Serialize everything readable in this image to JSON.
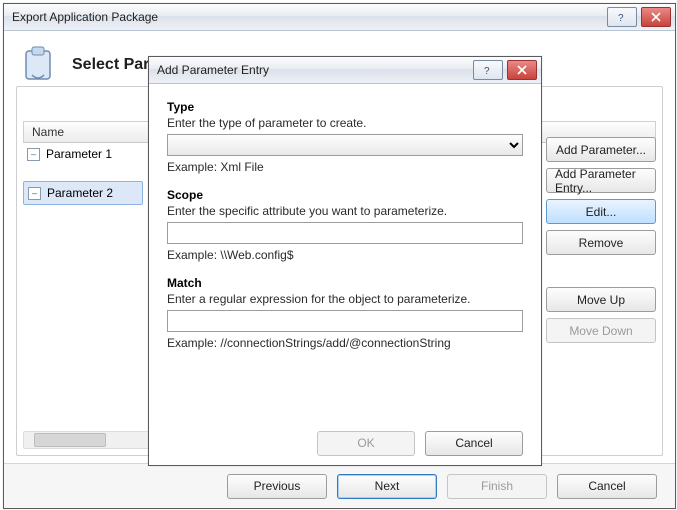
{
  "mainWindow": {
    "title": "Export Application Package",
    "heading": "Select Parameters",
    "gridHeader": "Name",
    "tree": {
      "items": [
        {
          "label": "Parameter 1"
        },
        {
          "label": "Parameter 2"
        }
      ]
    },
    "sideButtons": {
      "addParameter": "Add Parameter...",
      "addParameterEntry": "Add Parameter Entry...",
      "edit": "Edit...",
      "remove": "Remove",
      "moveUp": "Move Up",
      "moveDown": "Move Down"
    },
    "footer": {
      "previous": "Previous",
      "next": "Next",
      "finish": "Finish",
      "cancel": "Cancel"
    }
  },
  "dialog": {
    "title": "Add Parameter Entry",
    "type": {
      "heading": "Type",
      "hint": "Enter the type of parameter to create.",
      "value": "",
      "example": "Example: Xml File"
    },
    "scope": {
      "heading": "Scope",
      "hint": "Enter the specific attribute you want to parameterize.",
      "value": "",
      "example": "Example: \\\\Web.config$"
    },
    "match": {
      "heading": "Match",
      "hint": "Enter a regular expression for the object to parameterize.",
      "value": "",
      "example": "Example: //connectionStrings/add/@connectionString"
    },
    "buttons": {
      "ok": "OK",
      "cancel": "Cancel"
    }
  }
}
